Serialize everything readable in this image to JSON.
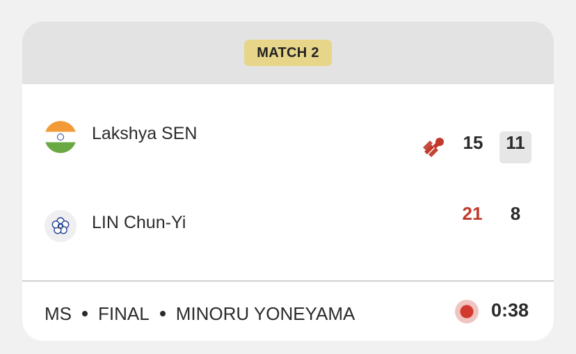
{
  "match": {
    "label": "MATCH 2"
  },
  "players": [
    {
      "name": "Lakshya SEN",
      "flag_icon": "india-flag-icon",
      "serving": true,
      "game1": "15",
      "game2": "11",
      "game1_color": "#2a2a2a"
    },
    {
      "name": "LIN Chun-Yi",
      "flag_icon": "chinese-taipei-flag-icon",
      "serving": false,
      "game1": "21",
      "game2": "8",
      "game1_color": "#c0392b"
    }
  ],
  "footer": {
    "event": "MS",
    "round": "FINAL",
    "venue": "MINORU YONEYAMA",
    "live_status_icon": "live-dot-icon",
    "elapsed": "0:38"
  },
  "colors": {
    "header_bg": "#e3e3e3",
    "badge_bg": "#e7d58a",
    "winner_score": "#c0392b",
    "shuttle_icon": "#c0392b",
    "live_dot": "#d23a30"
  }
}
